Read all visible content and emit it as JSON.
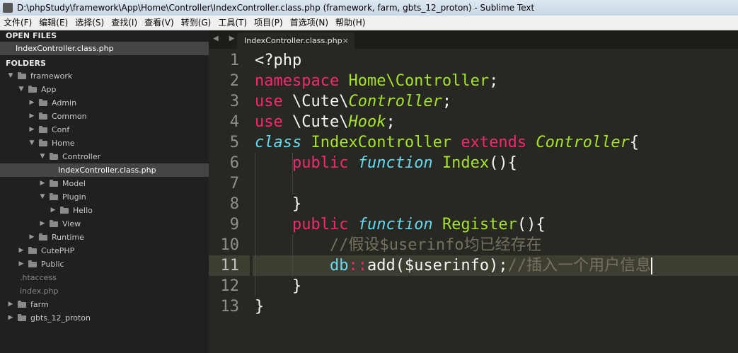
{
  "window": {
    "title": "D:\\phpStudy\\framework\\App\\Home\\Controller\\IndexController.class.php (framework, farm, gbts_12_proton) - Sublime Text"
  },
  "menu": [
    "文件(F)",
    "编辑(E)",
    "选择(S)",
    "查找(I)",
    "查看(V)",
    "转到(G)",
    "工具(T)",
    "项目(P)",
    "首选项(N)",
    "帮助(H)"
  ],
  "sidebar": {
    "open_files_header": "OPEN FILES",
    "open_file": "IndexController.class.php",
    "folders_header": "FOLDERS",
    "tree": [
      {
        "label": "framework",
        "depth": 0,
        "type": "folder",
        "expanded": true
      },
      {
        "label": "App",
        "depth": 1,
        "type": "folder",
        "expanded": true
      },
      {
        "label": "Admin",
        "depth": 2,
        "type": "folder",
        "expanded": false
      },
      {
        "label": "Common",
        "depth": 2,
        "type": "folder",
        "expanded": false
      },
      {
        "label": "Conf",
        "depth": 2,
        "type": "folder",
        "expanded": false
      },
      {
        "label": "Home",
        "depth": 2,
        "type": "folder",
        "expanded": true
      },
      {
        "label": "Controller",
        "depth": 3,
        "type": "folder",
        "expanded": true
      },
      {
        "label": "IndexController.class.php",
        "depth": 4,
        "type": "file",
        "selected": true
      },
      {
        "label": "Model",
        "depth": 3,
        "type": "folder",
        "expanded": false
      },
      {
        "label": "Plugin",
        "depth": 3,
        "type": "folder",
        "expanded": true
      },
      {
        "label": "Hello",
        "depth": 4,
        "type": "folder",
        "expanded": false
      },
      {
        "label": "View",
        "depth": 3,
        "type": "folder",
        "expanded": false
      },
      {
        "label": "Runtime",
        "depth": 2,
        "type": "folder",
        "expanded": false
      },
      {
        "label": "CutePHP",
        "depth": 1,
        "type": "folder",
        "expanded": false
      },
      {
        "label": "Public",
        "depth": 1,
        "type": "folder",
        "expanded": false
      },
      {
        "label": ".htaccess",
        "depth": 1,
        "type": "file"
      },
      {
        "label": "index.php",
        "depth": 1,
        "type": "file"
      },
      {
        "label": "farm",
        "depth": 0,
        "type": "folder",
        "expanded": false
      },
      {
        "label": "gbts_12_proton",
        "depth": 0,
        "type": "folder",
        "expanded": false
      }
    ]
  },
  "tabs": {
    "nav": "◀ ▶",
    "active_label": "IndexController.class.php",
    "close": "×"
  },
  "editor": {
    "current_line": 11,
    "lines": [
      {
        "n": "1",
        "tokens": [
          [
            "",
            "<?php"
          ]
        ]
      },
      {
        "n": "2",
        "tokens": [
          [
            "kw",
            "namespace"
          ],
          [
            "",
            " "
          ],
          [
            "fn",
            "Home\\Controller"
          ],
          [
            "",
            ";"
          ]
        ]
      },
      {
        "n": "3",
        "tokens": [
          [
            "kw",
            "use"
          ],
          [
            "",
            " \\Cute\\"
          ],
          [
            "ty",
            "Controller"
          ],
          [
            "",
            ";"
          ]
        ]
      },
      {
        "n": "4",
        "tokens": [
          [
            "kw",
            "use"
          ],
          [
            "",
            " \\Cute\\"
          ],
          [
            "ty",
            "Hook"
          ],
          [
            "",
            ";"
          ]
        ]
      },
      {
        "n": "5",
        "tokens": [
          [
            "st",
            "class"
          ],
          [
            "",
            " "
          ],
          [
            "fn",
            "IndexController"
          ],
          [
            "",
            " "
          ],
          [
            "kw",
            "extends"
          ],
          [
            "",
            " "
          ],
          [
            "ty",
            "Controller"
          ],
          [
            "",
            "{"
          ]
        ]
      },
      {
        "n": "6",
        "tokens": [
          [
            "",
            "    "
          ],
          [
            "kw",
            "public"
          ],
          [
            "",
            " "
          ],
          [
            "st",
            "function"
          ],
          [
            "",
            " "
          ],
          [
            "fn",
            "Index"
          ],
          [
            "",
            "(){"
          ]
        ]
      },
      {
        "n": "7",
        "tokens": []
      },
      {
        "n": "8",
        "tokens": [
          [
            "",
            "    }"
          ]
        ]
      },
      {
        "n": "9",
        "tokens": [
          [
            "",
            "    "
          ],
          [
            "kw",
            "public"
          ],
          [
            "",
            " "
          ],
          [
            "st",
            "function"
          ],
          [
            "",
            " "
          ],
          [
            "fn",
            "Register"
          ],
          [
            "",
            "(){"
          ]
        ]
      },
      {
        "n": "10",
        "tokens": [
          [
            "",
            "        "
          ],
          [
            "cm",
            "//假设$userinfo均已经存在"
          ]
        ]
      },
      {
        "n": "11",
        "tokens": [
          [
            "",
            "        "
          ],
          [
            "cx",
            "db"
          ],
          [
            "kw",
            "::"
          ],
          [
            "",
            "add($userinfo);"
          ],
          [
            "cm",
            "//插入一个用户信息"
          ]
        ],
        "cursor": true
      },
      {
        "n": "12",
        "tokens": [
          [
            "",
            "    }"
          ]
        ]
      },
      {
        "n": "13",
        "tokens": [
          [
            "",
            "}"
          ]
        ]
      }
    ]
  }
}
